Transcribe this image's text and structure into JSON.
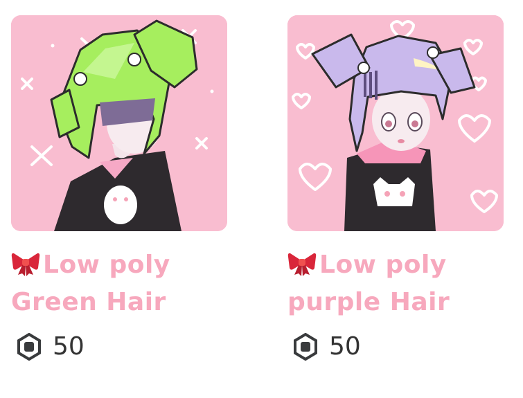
{
  "items": [
    {
      "name_line1": "Low poly",
      "name_line2": "Green Hair",
      "price": "50",
      "hair_color": "#a6ee5e",
      "accent_icon": "ribbon-bow-icon",
      "currency_icon": "robux-icon"
    },
    {
      "name_line1": "Low poly",
      "name_line2": "purple Hair",
      "price": "50",
      "hair_color": "#c9b9ec",
      "accent_icon": "ribbon-bow-icon",
      "currency_icon": "robux-icon"
    }
  ],
  "colors": {
    "thumbnail_background": "#f9bdd0",
    "item_name_text": "#f7a8bd",
    "price_text": "#333333"
  }
}
